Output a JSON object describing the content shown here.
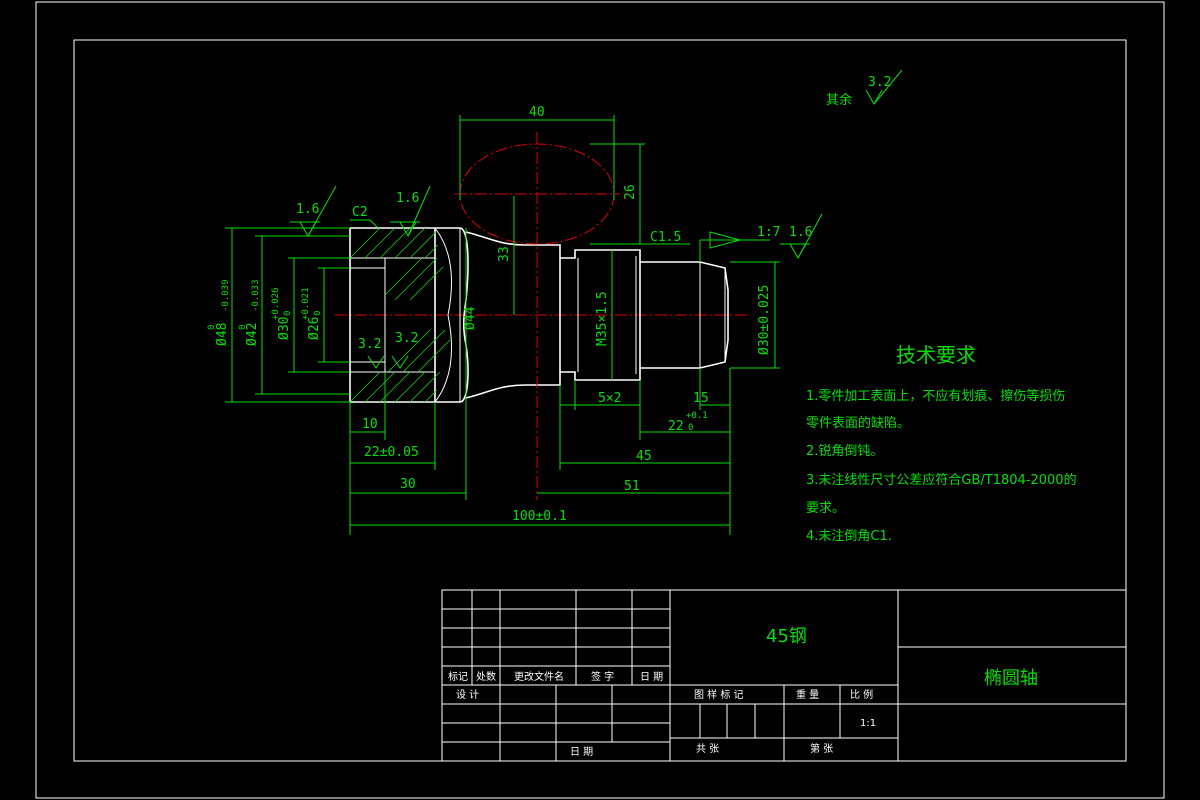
{
  "drawing": {
    "roughness_other": {
      "label": "其余",
      "value": "3.2"
    },
    "dims": {
      "len40": "40",
      "h26": "26",
      "h33": "33",
      "d44": "Ø44",
      "thread": "M35×1.5",
      "d30_right": "Ø30±0.025",
      "d48": "Ø48",
      "d48_tol": "-0.039",
      "d48_tol_up": "0",
      "d42": "Ø42",
      "d42_tol": "-0.033",
      "d42_tol_up": "0",
      "d30_left": "Ø30",
      "d30_tol": "+0.026",
      "d30_tol_low": "0",
      "d26": "Ø26",
      "d26_tol": "+0.021",
      "d26_tol_low": "0",
      "c2": "C2",
      "c15": "C1.5",
      "taper": "1:7",
      "r16a": "1.6",
      "r16b": "1.6",
      "r16c": "1.6",
      "r32a": "3.2",
      "r32b": "3.2",
      "l10": "10",
      "l22a": "22±0.05",
      "l30": "30",
      "l100": "100±0.1",
      "groove": "5×2",
      "l15": "15",
      "l22b": "22",
      "l22b_tol": "+0.1",
      "l22b_tol_low": "0",
      "l45": "45",
      "l51": "51"
    }
  },
  "tech": {
    "title": "技术要求",
    "lines": [
      "1.零件加工表面上，不应有划痕、擦伤等损伤",
      "零件表面的缺陷。",
      "2.锐角倒钝。",
      "3.未注线性尺寸公差应符合GB/T1804-2000的",
      "要求。",
      "4.未注倒角C1."
    ]
  },
  "titleblock": {
    "material": "45钢",
    "part_name": "椭圆轴",
    "h_mark": "标记",
    "h_count": "处数",
    "h_doc": "更改文件名",
    "h_sign": "签 字",
    "h_date": "日 期",
    "design": "设 计",
    "date2": "日 期",
    "stage": "图 样 标 记",
    "weight": "重 量",
    "ratio_label": "比 例",
    "ratio": "1:1",
    "sheets_total": "共      张",
    "sheet_no": "第      张"
  }
}
